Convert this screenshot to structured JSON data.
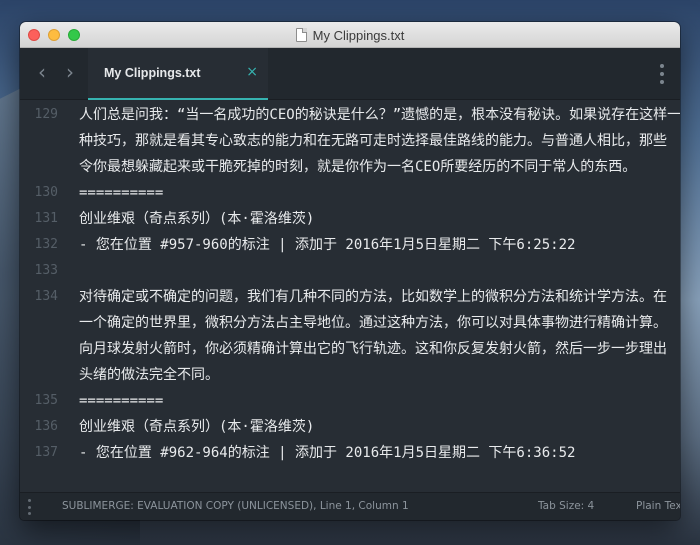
{
  "window": {
    "title": "My Clippings.txt"
  },
  "tab": {
    "label": "My Clippings.txt",
    "close_glyph": "×"
  },
  "nav": {
    "back_glyph": "‹",
    "forward_glyph": "›"
  },
  "editor": {
    "lines": [
      {
        "number": "129",
        "rows": [
          "人们总是问我：“当一名成功的CEO的秘诀是什么？”遗憾的是，根本没有秘诀。如果说存在这样一",
          "种技巧，那就是看其专心致志的能力和在无路可走时选择最佳路线的能力。与普通人相比，那些",
          "令你最想躲藏起来或干脆死掉的时刻，就是你作为一名CEO所要经历的不同于常人的东西。"
        ]
      },
      {
        "number": "130",
        "rows": [
          "=========="
        ]
      },
      {
        "number": "131",
        "rows": [
          "创业维艰（奇点系列）(本·霍洛维茨)"
        ]
      },
      {
        "number": "132",
        "rows": [
          "- 您在位置 #957-960的标注 | 添加于 2016年1月5日星期二 下午6:25:22"
        ]
      },
      {
        "number": "133",
        "rows": [
          ""
        ]
      },
      {
        "number": "134",
        "rows": [
          "对待确定或不确定的问题，我们有几种不同的方法，比如数学上的微积分方法和统计学方法。在",
          "一个确定的世界里，微积分方法占主导地位。通过这种方法，你可以对具体事物进行精确计算。",
          "向月球发射火箭时，你必须精确计算出它的飞行轨迹。这和你反复发射火箭，然后一步一步理出",
          "头绪的做法完全不同。"
        ]
      },
      {
        "number": "135",
        "rows": [
          "=========="
        ]
      },
      {
        "number": "136",
        "rows": [
          "创业维艰（奇点系列）(本·霍洛维茨)"
        ]
      },
      {
        "number": "137",
        "rows": [
          "- 您在位置 #962-964的标注 | 添加于 2016年1月5日星期二 下午6:36:52"
        ]
      }
    ]
  },
  "status": {
    "left": "SUBLIMERGE: EVALUATION COPY (UNLICENSED), Line 1, Column 1",
    "tab_size": "Tab Size: 4",
    "syntax": "Plain Text"
  },
  "colors": {
    "editor_bg": "#272d34",
    "accent": "#36b3b0",
    "text": "#e8eaec",
    "gutter": "#555e67"
  }
}
